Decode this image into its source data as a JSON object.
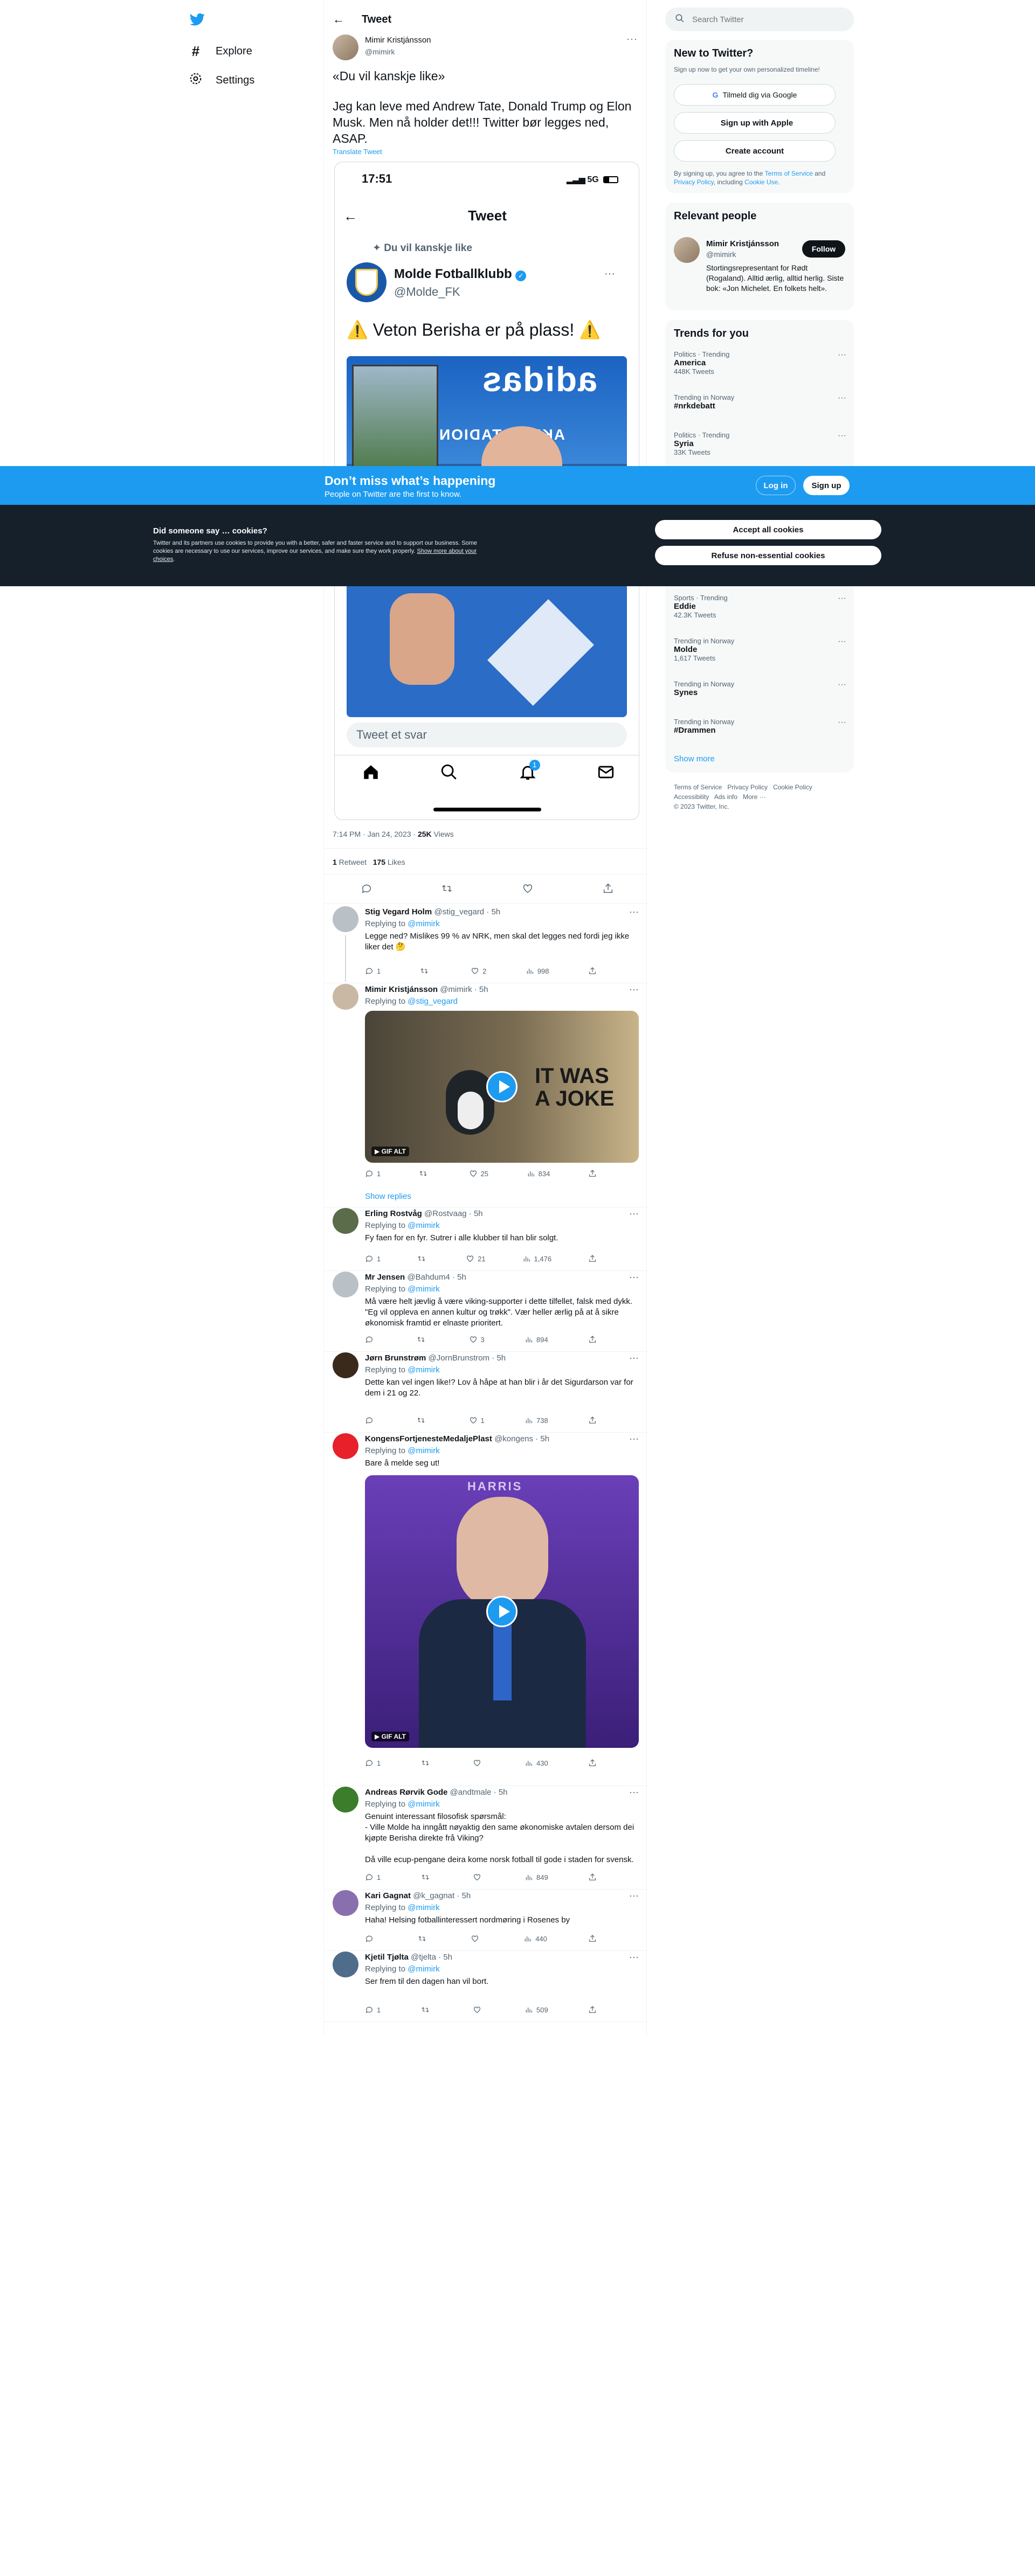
{
  "nav": {
    "items": [
      {
        "label": "Explore",
        "icon": "hashtag-icon"
      },
      {
        "label": "Settings",
        "icon": "gear-icon"
      }
    ]
  },
  "header": {
    "title": "Tweet"
  },
  "tweet": {
    "author": "Mimir Kristjánsson",
    "handle": "@mimirk",
    "line1": "«Du vil kanskje like»",
    "line2": "Jeg kan leve med Andrew Tate, Donald Trump og Elon Musk. Men nå holder det!!! Twitter bør legges ned, ASAP.",
    "translate": "Translate Tweet",
    "meta_time": "7:14 PM · Jan 24, 2023 · ",
    "views_count": "25K",
    "views_label": " Views",
    "retweets_count": "1",
    "retweets_label": " Retweet",
    "likes_count": "175",
    "likes_label": " Likes"
  },
  "phone": {
    "time": "17:51",
    "network": "5G",
    "title": "Tweet",
    "suggest": "Du vil kanskje like",
    "account_name": "Molde Fotballklubb",
    "account_handle": "@Molde_FK",
    "tweet_text": "⚠️ Veton Berisha er på plass! ⚠️",
    "stadium_text": "AKER STADION",
    "reply_placeholder": "Tweet et svar",
    "notif_count": "1"
  },
  "replies": [
    {
      "name": "Stig Vegard Holm",
      "handle": "@stig_vegard · 5h",
      "replying_to": "@mimirk",
      "text": "Legge ned?  Mislikes 99 % av NRK, men skal det legges ned fordi jeg ikke liker det 🤔",
      "comments": "1",
      "retweets": "",
      "likes": "2",
      "views": "998"
    },
    {
      "name": "Mimir Kristjánsson",
      "handle": "@mimirk · 5h",
      "replying_to": "@stig_vegard",
      "text": "",
      "comments": "1",
      "retweets": "",
      "likes": "25",
      "views": "834",
      "gif_text": "IT WAS A JOKE",
      "gif_label": "GIF",
      "alt_label": "ALT"
    },
    {
      "name": "Erling Rostvåg",
      "handle": "@Rostvaag · 5h",
      "replying_to": "@mimirk",
      "text": "Fy faen for en fyr. Sutrer i alle klubber til han blir solgt.",
      "comments": "1",
      "retweets": "",
      "likes": "21",
      "views": "1,476"
    },
    {
      "name": "Mr Jensen",
      "handle": "@Bahdum4 · 5h",
      "replying_to": "@mimirk",
      "text": "Må være helt jævlig å være viking-supporter i dette tilfellet, falsk med dykk. \"Eg vil oppleva en annen kultur og trøkk\". Vær heller ærlig på at å sikre økonomisk framtid er elnaste prioritert.",
      "comments": "",
      "retweets": "",
      "likes": "3",
      "views": "894"
    },
    {
      "name": "Jørn Brunstrøm",
      "handle": "@JornBrunstrom · 5h",
      "replying_to": "@mimirk",
      "text": "Dette kan vel ingen like!? Lov å håpe at han blir i år det Sigurdarson var for dem i 21 og 22.",
      "comments": "",
      "retweets": "",
      "likes": "1",
      "views": "738"
    },
    {
      "name": "KongensFortjenesteMedaljePlast",
      "handle": "@kongens · 5h",
      "replying_to": "@mimirk",
      "text": "Bare å melde seg ut!",
      "comments": "1",
      "retweets": "",
      "likes": "",
      "views": "430",
      "gif_label": "GIF",
      "alt_label": "ALT",
      "sign_text": "HARRIS"
    },
    {
      "name": "Andreas Rørvik Gode",
      "handle": "@andtmale · 5h",
      "replying_to": "@mimirk",
      "text": "Genuint interessant filosofisk spørsmål:\n- Ville Molde ha inngått nøyaktig den same økonomiske avtalen dersom dei kjøpte Berisha direkte frå Viking?\n\nDå ville ecup-pengane deira kome norsk fotball til gode i staden for svensk.",
      "comments": "1",
      "retweets": "",
      "likes": "",
      "views": "849"
    },
    {
      "name": "Kari Gagnat",
      "handle": "@k_gagnat · 5h",
      "replying_to": "@mimirk",
      "text": "Haha! Helsing fotballinteressert nordmøring i Rosenes by",
      "comments": "",
      "retweets": "",
      "likes": "",
      "views": "440"
    },
    {
      "name": "Kjetil Tjølta",
      "handle": "@tjelta · 5h",
      "replying_to": "@mimirk",
      "text": "Ser frem til den dagen han vil bort.",
      "comments": "1",
      "retweets": "",
      "likes": "",
      "views": "509"
    }
  ],
  "show_replies": "Show replies",
  "replying_label": "Replying to ",
  "search": {
    "placeholder": "Search Twitter"
  },
  "new_to_twitter": {
    "title": "New to Twitter?",
    "subtitle": "Sign up now to get your own personalized timeline!",
    "google_btn": "Tilmeld dig via Google",
    "apple_btn": "Sign up with Apple",
    "create_btn": "Create account",
    "legal_1": "By signing up, you agree to the ",
    "legal_terms": "Terms of Service",
    "legal_2": " and ",
    "legal_privacy": "Privacy Policy",
    "legal_3": ", including ",
    "legal_cookie": "Cookie Use",
    "legal_4": "."
  },
  "relevant": {
    "title": "Relevant people",
    "name": "Mimir Kristjánsson",
    "handle": "@mimirk",
    "follow_btn": "Follow",
    "bio": "Stortingsrepresentant for Rødt (Rogaland). Alltid ærlig, alltid herlig. Siste bok: «Jon Michelet. En folkets helt»."
  },
  "trends": {
    "title": "Trends for you",
    "items": [
      {
        "cat": "Politics · Trending",
        "name": "America",
        "count": "448K Tweets"
      },
      {
        "cat": "Trending in Norway",
        "name": "#nrkdebatt",
        "count": ""
      },
      {
        "cat": "Politics · Trending",
        "name": "Syria",
        "count": "33K Tweets"
      },
      {
        "cat": "Sports · Trending",
        "name": "Eddie",
        "count": "42.3K Tweets"
      },
      {
        "cat": "Trending in Norway",
        "name": "Molde",
        "count": "1,617 Tweets"
      },
      {
        "cat": "Trending in Norway",
        "name": "Synes",
        "count": ""
      },
      {
        "cat": "Trending in Norway",
        "name": "#Drammen",
        "count": ""
      }
    ],
    "show_more": "Show more"
  },
  "footer": {
    "links": [
      "Terms of Service",
      "Privacy Policy",
      "Cookie Policy",
      "Accessibility",
      "Ads info",
      "More ···"
    ],
    "copyright": "© 2023 Twitter, Inc."
  },
  "banner": {
    "title": "Don’t miss what’s happening",
    "subtitle": "People on Twitter are the first to know.",
    "login": "Log in",
    "signup": "Sign up"
  },
  "cookie": {
    "title": "Did someone say … cookies?",
    "text": "Twitter and its partners use cookies to provide you with a better, safer and faster service and to support our business. Some cookies are necessary to use our services, improve our services, and make sure they work properly. ",
    "link": "Show more about your choices",
    "accept": "Accept all cookies",
    "refuse": "Refuse non-essential cookies"
  },
  "colors": {
    "accent": "#1d9bf0",
    "banner": "#1d9bf0",
    "cookie_bg": "#15202b"
  }
}
